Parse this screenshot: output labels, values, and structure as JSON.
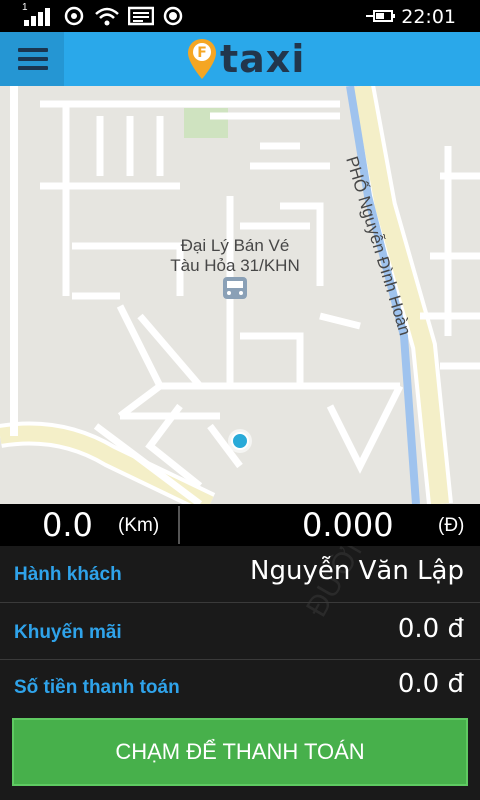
{
  "status_bar": {
    "time": "22:01",
    "signal_label": "1",
    "icons": [
      "signal-icon",
      "sync-icon",
      "wifi-icon",
      "message-icon",
      "location-icon",
      "battery-charging-icon"
    ]
  },
  "header": {
    "menu_icon": "hamburger-menu-icon",
    "logo_badge": "F",
    "logo_text": "taxi",
    "brand_color": "#2aa8ea",
    "logo_orange": "#f5a623"
  },
  "map": {
    "poi_line1": "Đại Lý Bán Vé",
    "poi_line2": "Tàu Hỏa 31/KHN",
    "poi_icon": "train-icon",
    "street_label": "PHỐ Nguyễn Đình Hoàn",
    "location_marker": "current-location-dot",
    "location_color": "#29aad8"
  },
  "meter": {
    "distance_value": "0.0",
    "distance_unit": "(Km)",
    "fare_value": "0.000",
    "fare_unit": "(Đ)"
  },
  "panel": {
    "watermark": "ĐƯỜNG B",
    "passenger_label": "Hành khách",
    "passenger_value": "Nguyễn Văn Lập",
    "promo_label": "Khuyến mãi",
    "promo_value": "0.0 đ",
    "payment_label": "Số tiền thanh toán",
    "payment_value": "0.0 đ",
    "accent_color": "#2fa3ea"
  },
  "pay_button": {
    "label": "CHẠM ĐỂ THANH TOÁN",
    "color": "#47b04b"
  }
}
